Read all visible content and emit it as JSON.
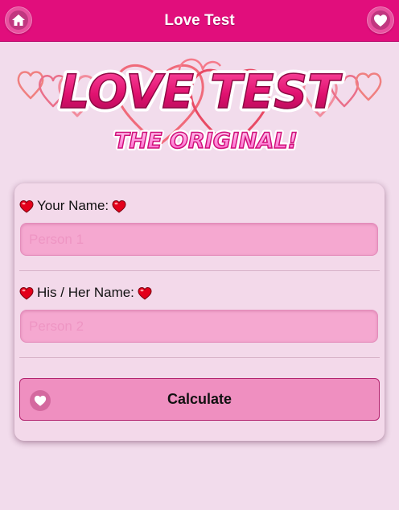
{
  "header": {
    "title": "Love Test",
    "home_icon": "home-icon",
    "favorite_icon": "heart-icon"
  },
  "logo": {
    "line1": "LOVE TEST",
    "line2": "THE ORIGINAL!"
  },
  "form": {
    "name1": {
      "label": "Your Name:",
      "placeholder": "Person 1",
      "value": ""
    },
    "name2": {
      "label": "His / Her Name:",
      "placeholder": "Person 2",
      "value": ""
    },
    "calculate": {
      "label": "Calculate",
      "icon": "heart-icon"
    }
  },
  "colors": {
    "header": "#e10e7c",
    "background": "#f2dcec",
    "input": "#f5a8d0",
    "button": "#ef8fc0"
  }
}
